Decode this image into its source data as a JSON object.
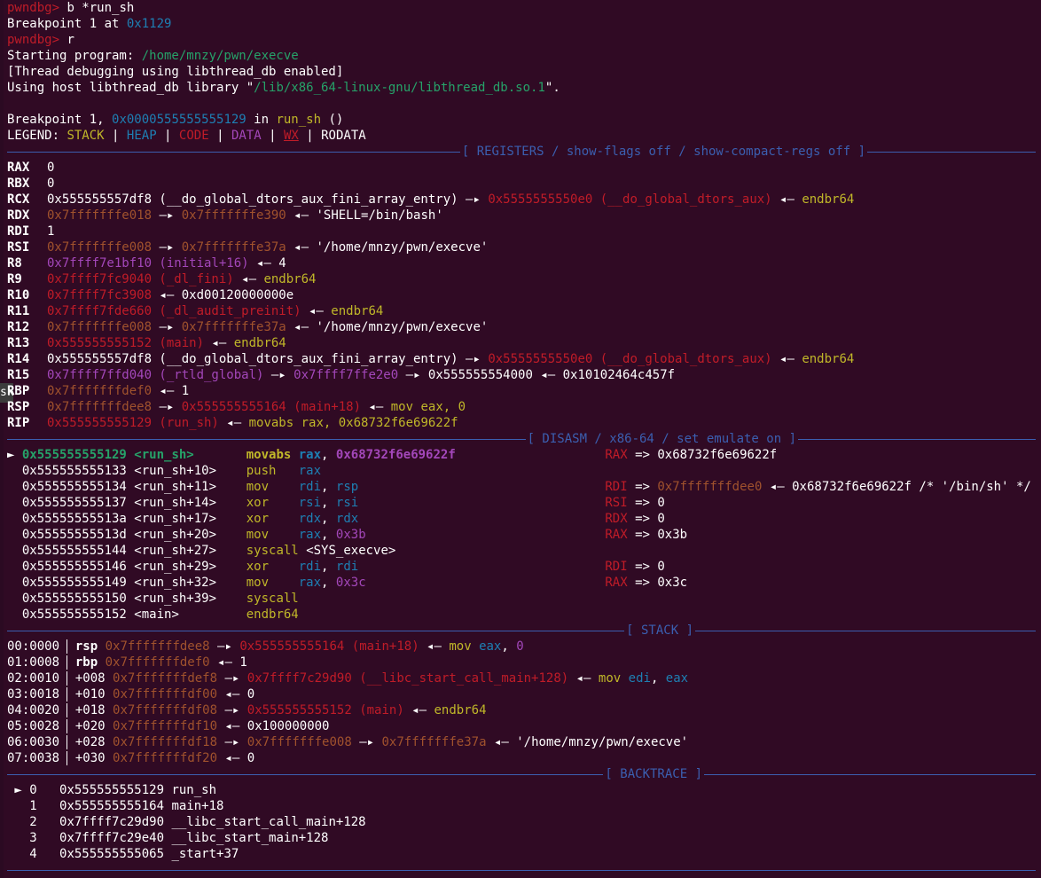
{
  "colors": {
    "background": "#300a24",
    "prompt": "#c01c28",
    "address": "#2aa1b3",
    "path_green": "#26a269",
    "heap_brown": "#a0522d",
    "code_red": "#c01c28",
    "data_purple": "#a347ba",
    "stack_yellow": "#c0b729",
    "separator_blue": "#3b5fb0"
  },
  "header": [
    {
      "prompt": "pwndbg>",
      "cmd": " b *run_sh"
    },
    {
      "text": "Breakpoint 1 at ",
      "addr": "0x1129"
    },
    {
      "prompt": "pwndbg>",
      "cmd": " r"
    },
    {
      "text": "Starting program: ",
      "path": "/home/mnzy/pwn/execve"
    },
    {
      "text": "[Thread debugging using libthread_db enabled]"
    },
    {
      "text": "Using host libthread_db library \"",
      "path": "/lib/x86_64-linux-gnu/libthread_db.so.1",
      "tail": "\"."
    },
    {
      "text": ""
    },
    {
      "text": "Breakpoint 1, ",
      "addr": "0x0000555555555129",
      "mid": " in ",
      "fn": "run_sh",
      "tail": " ()"
    }
  ],
  "legend": {
    "label": "LEGEND:",
    "items": [
      "STACK",
      "HEAP",
      "CODE",
      "DATA",
      "WX",
      "RODATA"
    ]
  },
  "sections": {
    "registers": "[ REGISTERS / show-flags off / show-compact-regs off ]",
    "disasm": "[ DISASM / x86-64 / set emulate on ]",
    "stack": "[ STACK ]",
    "backtrace": "[ BACKTRACE ]"
  },
  "registers": [
    {
      "name": "RAX",
      "v1": "0"
    },
    {
      "name": "RBX",
      "v1": "0"
    },
    {
      "name": "RCX",
      "v1": "0x555555557df8 (__do_global_dtors_aux_fini_array_entry)",
      "arrow": " —▸ ",
      "v2": "0x5555555550e0 (__do_global_dtors_aux)",
      "arrow2": " ◂— ",
      "v3": "endbr64"
    },
    {
      "name": "RDX",
      "v1": "0x7fffffffe018",
      "arrow": " —▸ ",
      "v2": "0x7fffffffe390",
      "arrow2": " ◂— ",
      "v3": "'SHELL=/bin/bash'"
    },
    {
      "name": "RDI",
      "v1": "1"
    },
    {
      "name": "RSI",
      "v1": "0x7fffffffe008",
      "arrow": " —▸ ",
      "v2": "0x7fffffffe37a",
      "arrow2": " ◂— ",
      "v3": "'/home/mnzy/pwn/execve'"
    },
    {
      "name": "R8",
      "v1": "0x7ffff7e1bf10 (initial+16)",
      "arrow2": " ◂— ",
      "v3": "4"
    },
    {
      "name": "R9",
      "v1": "0x7ffff7fc9040 (_dl_fini)",
      "arrow2": " ◂— ",
      "v3": "endbr64"
    },
    {
      "name": "R10",
      "v1": "0x7ffff7fc3908",
      "arrow2": " ◂— ",
      "v3": "0xd00120000000e"
    },
    {
      "name": "R11",
      "v1": "0x7ffff7fde660 (_dl_audit_preinit)",
      "arrow2": " ◂— ",
      "v3": "endbr64"
    },
    {
      "name": "R12",
      "v1": "0x7fffffffe008",
      "arrow": " —▸ ",
      "v2": "0x7fffffffe37a",
      "arrow2": " ◂— ",
      "v3": "'/home/mnzy/pwn/execve'"
    },
    {
      "name": "R13",
      "v1": "0x555555555152 (main)",
      "arrow2": " ◂— ",
      "v3": "endbr64"
    },
    {
      "name": "R14",
      "v1": "0x555555557df8 (__do_global_dtors_aux_fini_array_entry)",
      "arrow": " —▸ ",
      "v2": "0x5555555550e0 (__do_global_dtors_aux)",
      "arrow2": " ◂— ",
      "v3": "endbr64"
    },
    {
      "name": "R15",
      "v1": "0x7ffff7ffd040 (_rtld_global)",
      "arrow": " —▸ ",
      "v2": "0x7ffff7ffe2e0",
      "arrow3": " —▸ ",
      "v4": "0x555555554000",
      "arrow2": " ◂— ",
      "v3": "0x10102464c457f"
    },
    {
      "name": "RBP",
      "v1": "0x7fffffffdef0",
      "arrow2": " ◂— ",
      "v3": "1"
    },
    {
      "name": "RSP",
      "v1": "0x7fffffffdee8",
      "arrow": " —▸ ",
      "v2": "0x555555555164 (main+18)",
      "arrow2": " ◂— ",
      "v3": "mov eax, 0"
    },
    {
      "name": "RIP",
      "v1": "0x555555555129 (run_sh)",
      "arrow2": " ◂— ",
      "v3": "movabs rax, 0x68732f6e69622f"
    }
  ],
  "disasm": [
    {
      "marker": "►",
      "addr": "0x555555555129",
      "sym": "<run_sh>",
      "op": "movabs",
      "args": "rax, 0x68732f6e69622f",
      "emu": "RAX => 0x68732f6e69622f"
    },
    {
      "addr": "0x555555555133",
      "sym": "<run_sh+10>",
      "op": "push",
      "args": "rax"
    },
    {
      "addr": "0x555555555134",
      "sym": "<run_sh+11>",
      "op": "mov",
      "args": "rdi, rsp",
      "emu": "RDI => 0x7fffffffdee0 ◂— 0x68732f6e69622f /* '/bin/sh' */"
    },
    {
      "addr": "0x555555555137",
      "sym": "<run_sh+14>",
      "op": "xor",
      "args": "rsi, rsi",
      "emu": "RSI => 0"
    },
    {
      "addr": "0x55555555513a",
      "sym": "<run_sh+17>",
      "op": "xor",
      "args": "rdx, rdx",
      "emu": "RDX => 0"
    },
    {
      "addr": "0x55555555513d",
      "sym": "<run_sh+20>",
      "op": "mov",
      "args": "rax, 0x3b",
      "emu": "RAX => 0x3b"
    },
    {
      "addr": "0x555555555144",
      "sym": "<run_sh+27>",
      "op": "syscall",
      "args": "<SYS_execve>"
    },
    {
      "addr": "0x555555555146",
      "sym": "<run_sh+29>",
      "op": "xor",
      "args": "rdi, rdi",
      "emu": "RDI => 0"
    },
    {
      "addr": "0x555555555149",
      "sym": "<run_sh+32>",
      "op": "mov",
      "args": "rax, 0x3c",
      "emu": "RAX => 0x3c"
    },
    {
      "addr": "0x555555555150",
      "sym": "<run_sh+39>",
      "op": "syscall",
      "args": ""
    },
    {
      "addr": "0x555555555152",
      "sym": "<main>",
      "op": "endbr64",
      "args": ""
    }
  ],
  "stack": [
    {
      "idx": "00:0000",
      "reg": "rsp",
      "off": "",
      "addr": "0x7fffffffdee8",
      "a1": " —▸ ",
      "v1": "0x555555555164 (main+18)",
      "a2": " ◂— ",
      "v2": "mov eax, 0"
    },
    {
      "idx": "01:0008",
      "reg": "rbp",
      "off": "",
      "addr": "0x7fffffffdef0",
      "a2": " ◂— ",
      "v2": "1"
    },
    {
      "idx": "02:0010",
      "reg": "",
      "off": "+008",
      "addr": "0x7fffffffdef8",
      "a1": " —▸ ",
      "v1": "0x7ffff7c29d90 (__libc_start_call_main+128)",
      "a2": " ◂— ",
      "v2": "mov edi, eax"
    },
    {
      "idx": "03:0018",
      "reg": "",
      "off": "+010",
      "addr": "0x7fffffffdf00",
      "a2": " ◂— ",
      "v2": "0"
    },
    {
      "idx": "04:0020",
      "reg": "",
      "off": "+018",
      "addr": "0x7fffffffdf08",
      "a1": " —▸ ",
      "v1": "0x555555555152 (main)",
      "a2": " ◂— ",
      "v2": "endbr64"
    },
    {
      "idx": "05:0028",
      "reg": "",
      "off": "+020",
      "addr": "0x7fffffffdf10",
      "a2": " ◂— ",
      "v2": "0x100000000"
    },
    {
      "idx": "06:0030",
      "reg": "",
      "off": "+028",
      "addr": "0x7fffffffdf18",
      "a1": " —▸ ",
      "v1": "0x7fffffffe008",
      "a3": " —▸ ",
      "v3": "0x7fffffffe37a",
      "a2": " ◂— ",
      "v2": "'/home/mnzy/pwn/execve'"
    },
    {
      "idx": "07:0038",
      "reg": "",
      "off": "+030",
      "addr": "0x7fffffffdf20",
      "a2": " ◂— ",
      "v2": "0"
    }
  ],
  "backtrace": [
    {
      "marker": "►",
      "num": "0",
      "addr": "0x555555555129",
      "fn": "run_sh"
    },
    {
      "num": "1",
      "addr": "0x555555555164",
      "fn": "main+18"
    },
    {
      "num": "2",
      "addr": "0x7ffff7c29d90",
      "fn": "__libc_start_call_main+128"
    },
    {
      "num": "3",
      "addr": "0x7ffff7c29e40",
      "fn": "__libc_start_main+128"
    },
    {
      "num": "4",
      "addr": "0x555555555065",
      "fn": "_start+37"
    }
  ],
  "side_tab_label": "sk"
}
